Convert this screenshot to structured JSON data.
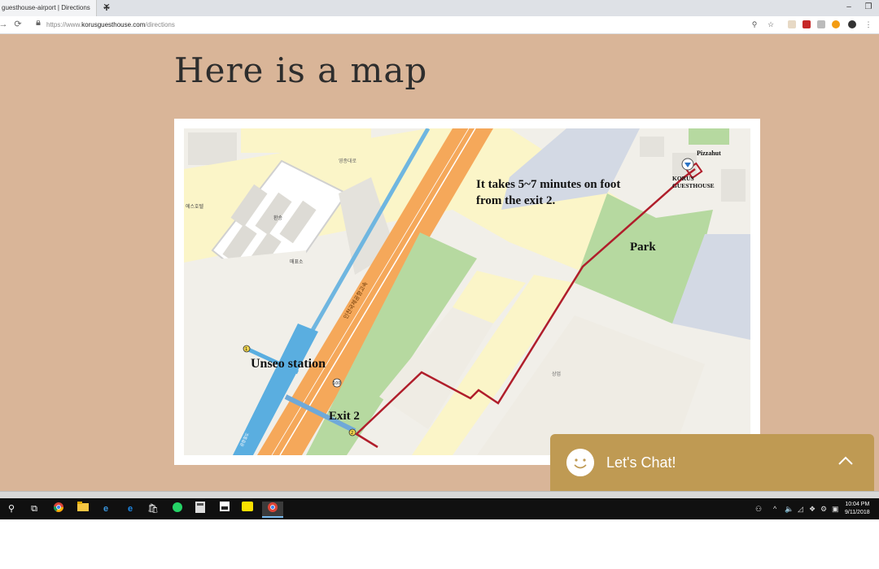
{
  "browser": {
    "tab_title": "guesthouse-airport | Directions",
    "tab_close": "✕",
    "new_tab": "+",
    "url_prefix": "https://www.",
    "url_domain": "korusguesthouse.com",
    "url_path": "/directions",
    "back_icon": "back-arrow-icon",
    "reload_icon": "reload-icon",
    "minimize_icon": "minimize-icon",
    "restore_icon": "restore-icon"
  },
  "page": {
    "title": "Here is a map",
    "background": "#d9b598"
  },
  "map": {
    "note_line1": "It takes 5~7 minutes on foot",
    "note_line2": "from the exit 2.",
    "park": "Park",
    "station": "Unseo station",
    "exit": "Exit 2",
    "pizza": "Pizzahut",
    "guesthouse_line1": "KORUS",
    "guesthouse_line2": "GUESTHOUSE",
    "route_color": "#b01e2b",
    "korean_labels": [
      "영종대로",
      "에스호텔",
      "환승",
      "매표소",
      "인천국제공항고속",
      "공항철도",
      "상업"
    ],
    "road_sign": "100",
    "exit_marker": "2",
    "station_marker": "1"
  },
  "chat": {
    "label": "Let's Chat!",
    "color": "#bf9a53"
  },
  "taskbar": {
    "time": "10:04 PM",
    "date": "9/11/2018"
  }
}
